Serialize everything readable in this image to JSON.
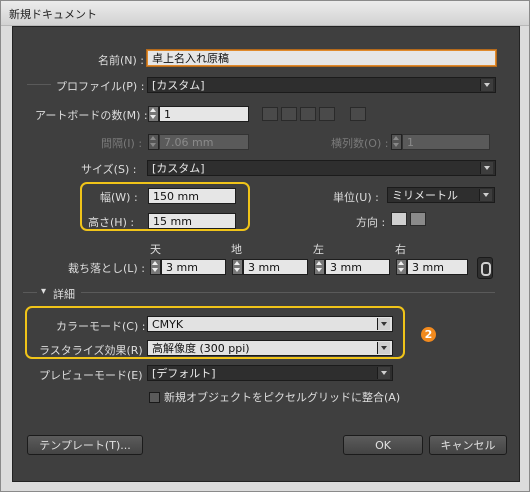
{
  "window": {
    "title": "新規ドキュメント"
  },
  "name": {
    "label": "名前(N) :",
    "value": "卓上名入れ原稿"
  },
  "profile": {
    "label": "プロファイル(P) :",
    "value": "[カスタム]"
  },
  "artboards": {
    "count_label": "アートボードの数(M) :",
    "count_value": "1",
    "spacing_label": "間隔(I) :",
    "spacing_value": "7.06 mm",
    "columns_label": "横列数(O) :",
    "columns_value": "1"
  },
  "size": {
    "label": "サイズ(S) :",
    "value": "[カスタム]"
  },
  "width": {
    "label": "幅(W) :",
    "value": "150 mm"
  },
  "height": {
    "label": "高さ(H) :",
    "value": "15 mm"
  },
  "units": {
    "label": "単位(U) :",
    "value": "ミリメートル"
  },
  "orientation": {
    "label": "方向 :"
  },
  "bleed": {
    "label": "裁ち落とし(L) :",
    "top_label": "天",
    "top_value": "3 mm",
    "bottom_label": "地",
    "bottom_value": "3 mm",
    "left_label": "左",
    "left_value": "3 mm",
    "right_label": "右",
    "right_value": "3 mm"
  },
  "advanced": {
    "toggle_label": "詳細",
    "color_mode_label": "カラーモード(C) :",
    "color_mode_value": "CMYK",
    "raster_label": "ラスタライズ効果(R) :",
    "raster_value": "高解像度 (300 ppi)",
    "preview_label": "プレビューモード(E) :",
    "preview_value": "[デフォルト]",
    "pixel_grid_label": "新規オブジェクトをピクセルグリッドに整合(A)"
  },
  "annotation_badge": "2",
  "buttons": {
    "templates": "テンプレート(T)...",
    "ok": "OK",
    "cancel": "キャンセル"
  },
  "colors": {
    "highlight": "#f0c419",
    "badge": "#f28a1e",
    "panel": "#3f3f3f"
  }
}
